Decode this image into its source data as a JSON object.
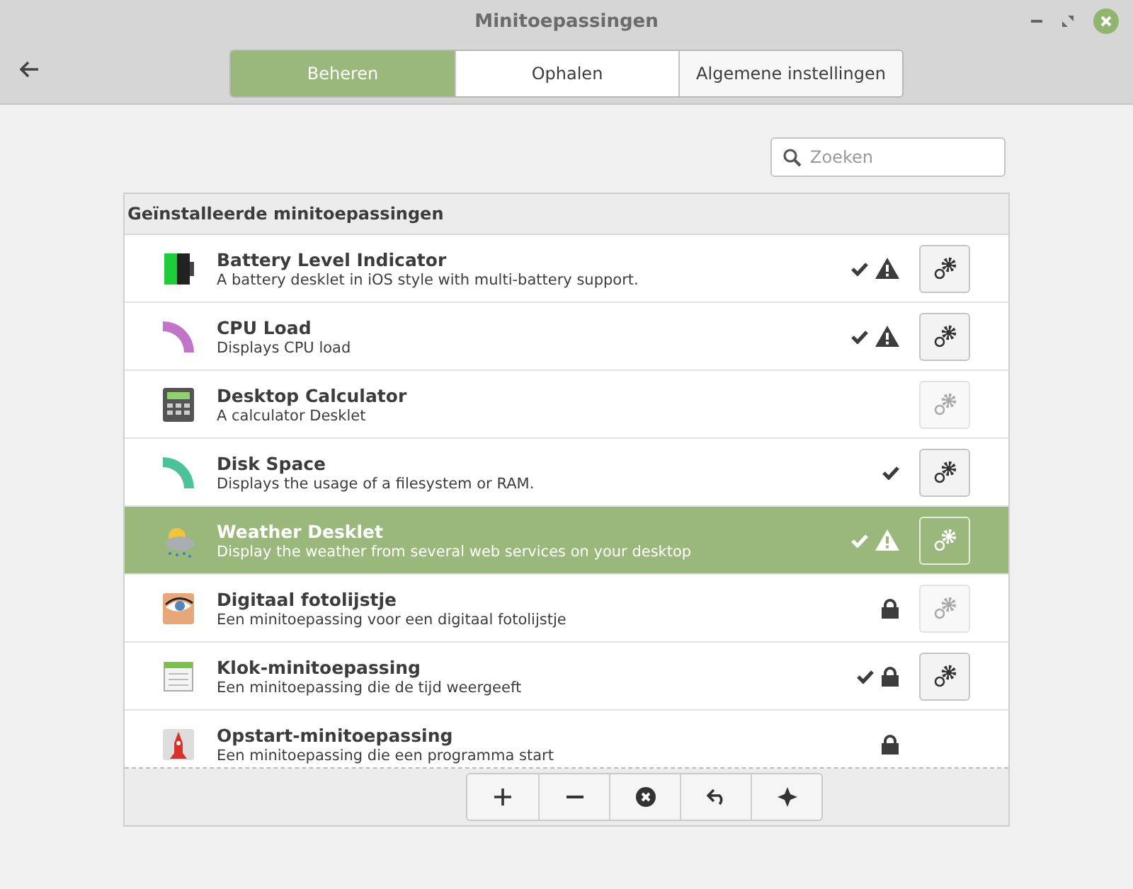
{
  "window": {
    "title": "Minitoepassingen"
  },
  "tabs": [
    {
      "label": "Beheren",
      "selected": true
    },
    {
      "label": "Ophalen",
      "selected": false
    },
    {
      "label": "Algemene instellingen",
      "selected": false
    }
  ],
  "search": {
    "placeholder": "Zoeken"
  },
  "list": {
    "heading": "Geïnstalleerde minitoepassingen",
    "rows": [
      {
        "name": "Battery Level Indicator",
        "description": "A battery desklet in iOS style with multi-battery support.",
        "active": true,
        "warning": true,
        "locked": false,
        "has_config": true,
        "config_disabled": false,
        "selected": false
      },
      {
        "name": "CPU Load",
        "description": "Displays CPU load",
        "active": true,
        "warning": true,
        "locked": false,
        "has_config": true,
        "config_disabled": false,
        "selected": false
      },
      {
        "name": "Desktop Calculator",
        "description": "A calculator Desklet",
        "active": false,
        "warning": false,
        "locked": false,
        "has_config": true,
        "config_disabled": true,
        "selected": false
      },
      {
        "name": "Disk Space",
        "description": "Displays the usage of a filesystem or RAM.",
        "active": true,
        "warning": false,
        "locked": false,
        "has_config": true,
        "config_disabled": false,
        "selected": false
      },
      {
        "name": "Weather Desklet",
        "description": "Display the weather from several web services on your desktop",
        "active": true,
        "warning": true,
        "locked": false,
        "has_config": true,
        "config_disabled": false,
        "selected": true
      },
      {
        "name": "Digitaal fotolijstje",
        "description": "Een minitoepassing voor een digitaal fotolijstje",
        "active": false,
        "warning": false,
        "locked": true,
        "has_config": true,
        "config_disabled": true,
        "selected": false
      },
      {
        "name": "Klok-minitoepassing",
        "description": "Een minitoepassing die de tijd weergeeft",
        "active": true,
        "warning": false,
        "locked": true,
        "has_config": true,
        "config_disabled": false,
        "selected": false
      },
      {
        "name": "Opstart-minitoepassing",
        "description": "Een minitoepassing die een programma start",
        "active": false,
        "warning": false,
        "locked": true,
        "has_config": false,
        "config_disabled": false,
        "selected": false
      }
    ]
  }
}
